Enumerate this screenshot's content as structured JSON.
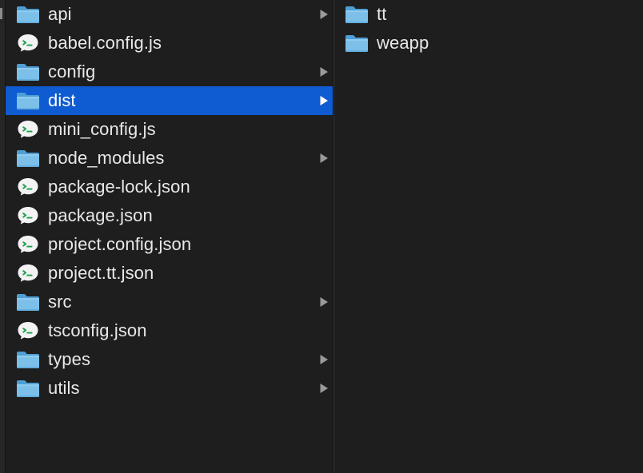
{
  "columns": [
    {
      "items": [
        {
          "label": "api",
          "kind": "folder",
          "expandable": true,
          "selected": false
        },
        {
          "label": "babel.config.js",
          "kind": "file",
          "expandable": false,
          "selected": false
        },
        {
          "label": "config",
          "kind": "folder",
          "expandable": true,
          "selected": false
        },
        {
          "label": "dist",
          "kind": "folder",
          "expandable": true,
          "selected": true
        },
        {
          "label": "mini_config.js",
          "kind": "file",
          "expandable": false,
          "selected": false
        },
        {
          "label": "node_modules",
          "kind": "folder",
          "expandable": true,
          "selected": false
        },
        {
          "label": "package-lock.json",
          "kind": "file",
          "expandable": false,
          "selected": false
        },
        {
          "label": "package.json",
          "kind": "file",
          "expandable": false,
          "selected": false
        },
        {
          "label": "project.config.json",
          "kind": "file",
          "expandable": false,
          "selected": false
        },
        {
          "label": "project.tt.json",
          "kind": "file",
          "expandable": false,
          "selected": false
        },
        {
          "label": "src",
          "kind": "folder",
          "expandable": true,
          "selected": false
        },
        {
          "label": "tsconfig.json",
          "kind": "file",
          "expandable": false,
          "selected": false
        },
        {
          "label": "types",
          "kind": "folder",
          "expandable": true,
          "selected": false
        },
        {
          "label": "utils",
          "kind": "folder",
          "expandable": true,
          "selected": false
        }
      ]
    },
    {
      "items": [
        {
          "label": "tt",
          "kind": "folder",
          "expandable": false,
          "selected": false
        },
        {
          "label": "weapp",
          "kind": "folder",
          "expandable": false,
          "selected": false
        }
      ]
    }
  ],
  "icons": {
    "folder": "folder-icon",
    "file": "wechat-devtools-file-icon",
    "chevron": "chevron-right-icon"
  },
  "colors": {
    "background": "#1e1e1e",
    "selection": "#0f5bd2",
    "text": "#e8e8e8",
    "folder_light": "#7cc0ea",
    "folder_dark": "#4f9fd4",
    "chevron": "#9a9a9a"
  }
}
